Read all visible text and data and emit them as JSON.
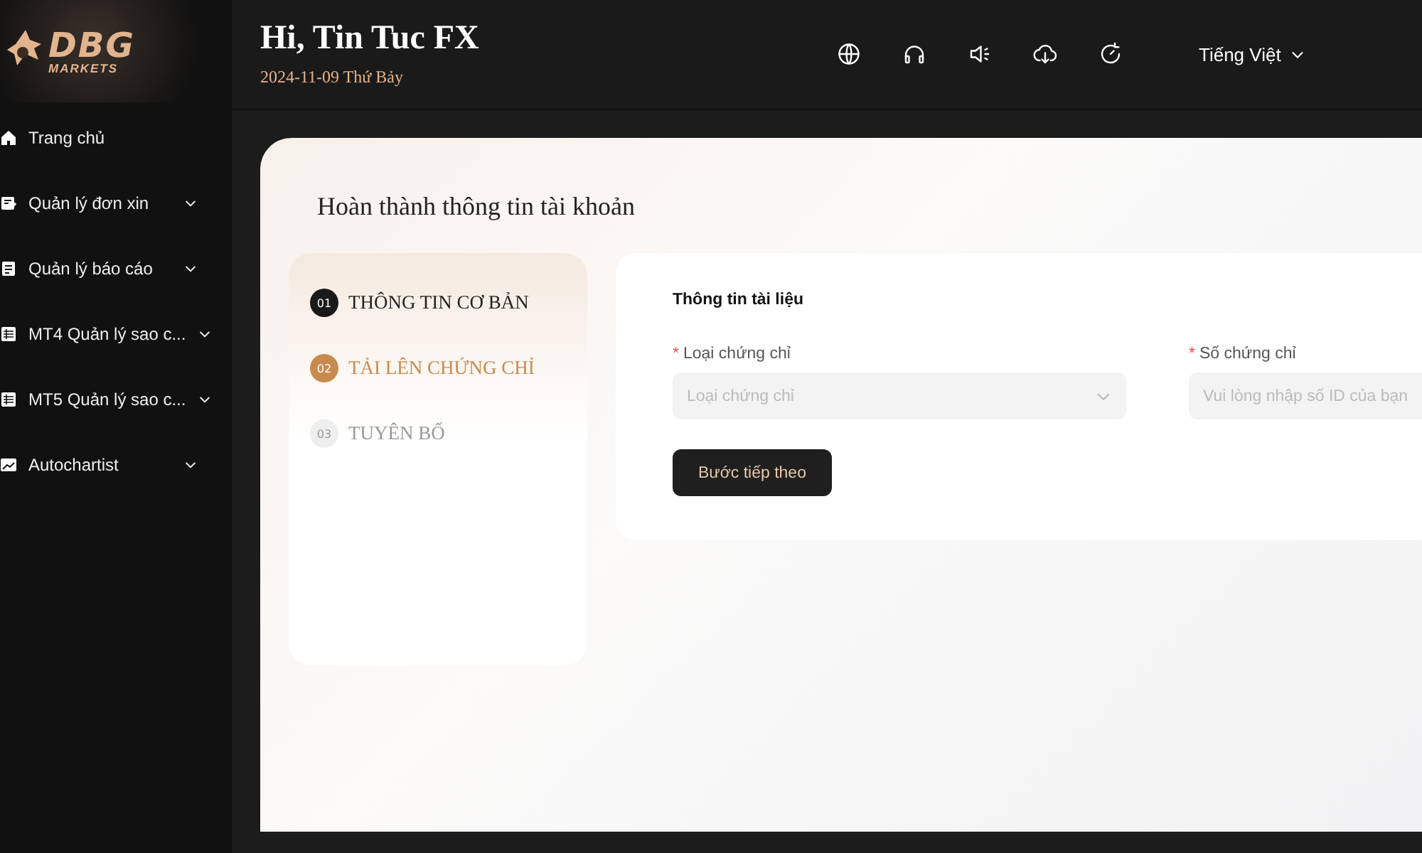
{
  "logo": {
    "brand": "DBG",
    "sub": "MARKETS"
  },
  "sidebar": {
    "items": [
      {
        "label": "Trang chủ",
        "expandable": false
      },
      {
        "label": "Quản lý đơn xin",
        "expandable": true
      },
      {
        "label": "Quản lý báo cáo",
        "expandable": true
      },
      {
        "label": "MT4 Quản lý sao c...",
        "expandable": true
      },
      {
        "label": "MT5 Quản lý sao c...",
        "expandable": true
      },
      {
        "label": "Autochartist",
        "expandable": true
      }
    ]
  },
  "header": {
    "greeting": "Hi, Tin Tuc FX",
    "date": "2024-11-09 Thứ Bảy",
    "language": "Tiếng Việt"
  },
  "page": {
    "title": "Hoàn thành thông tin tài khoản",
    "steps": [
      {
        "number": "01",
        "label": "THÔNG TIN CƠ BẢN",
        "completed": true,
        "selected": false
      },
      {
        "number": "02",
        "label": "TẢI LÊN CHỨNG CHỈ",
        "completed": false,
        "selected": true
      },
      {
        "number": "03",
        "label": "TUYÊN BỐ",
        "completed": false,
        "selected": false
      }
    ],
    "form": {
      "title": "Thông tin tài liệu",
      "fields": [
        {
          "kind": "select",
          "required_mark": "*",
          "label": "Loại chứng chỉ",
          "placeholder": "Loại chứng chỉ"
        },
        {
          "kind": "input",
          "required_mark": "*",
          "label": "Số chứng chỉ",
          "placeholder": "Vui lòng nhập số ID của bạn"
        }
      ],
      "button": "Bước tiếp theo"
    }
  }
}
